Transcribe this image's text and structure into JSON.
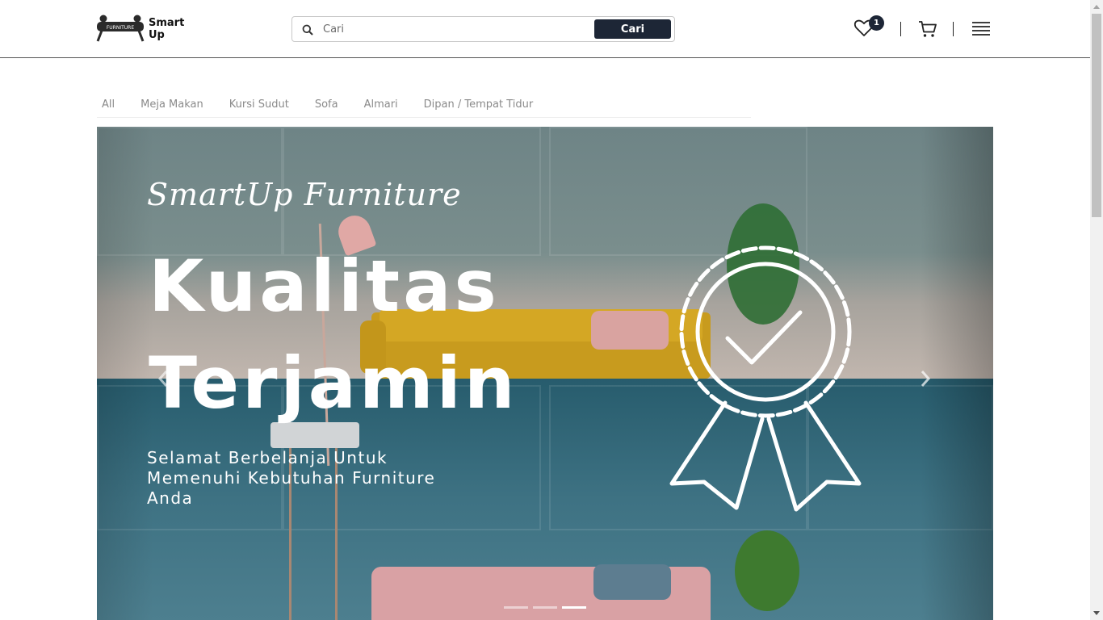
{
  "brand": {
    "line1": "Smart",
    "line2": "Up",
    "mark_text": "FURNITURE"
  },
  "search": {
    "placeholder": "Cari",
    "value": "",
    "button_label": "Cari"
  },
  "header": {
    "wishlist_count": "1"
  },
  "categories": [
    "All",
    "Meja Makan",
    "Kursi Sudut",
    "Sofa",
    "Almari",
    "Dipan / Tempat Tidur"
  ],
  "hero": {
    "script_title": "SmartUp Furniture",
    "headline_line1": "Kualitas",
    "headline_line2": "Terjamin",
    "subtitle": "Selamat Berbelanja Untuk Memenuhi Kebutuhan Furniture Anda",
    "slide_count": 3,
    "active_slide": 3
  },
  "icons": {
    "search": "search-icon",
    "wishlist": "heart-icon",
    "cart": "cart-icon",
    "menu": "hamburger-menu-icon",
    "prev": "chevron-left-icon",
    "next": "chevron-right-icon",
    "badge": "quality-award-badge-icon"
  },
  "colors": {
    "primary": "#1d2636",
    "category_text": "#8a8a8a",
    "hero_teal": "#3e7283"
  }
}
